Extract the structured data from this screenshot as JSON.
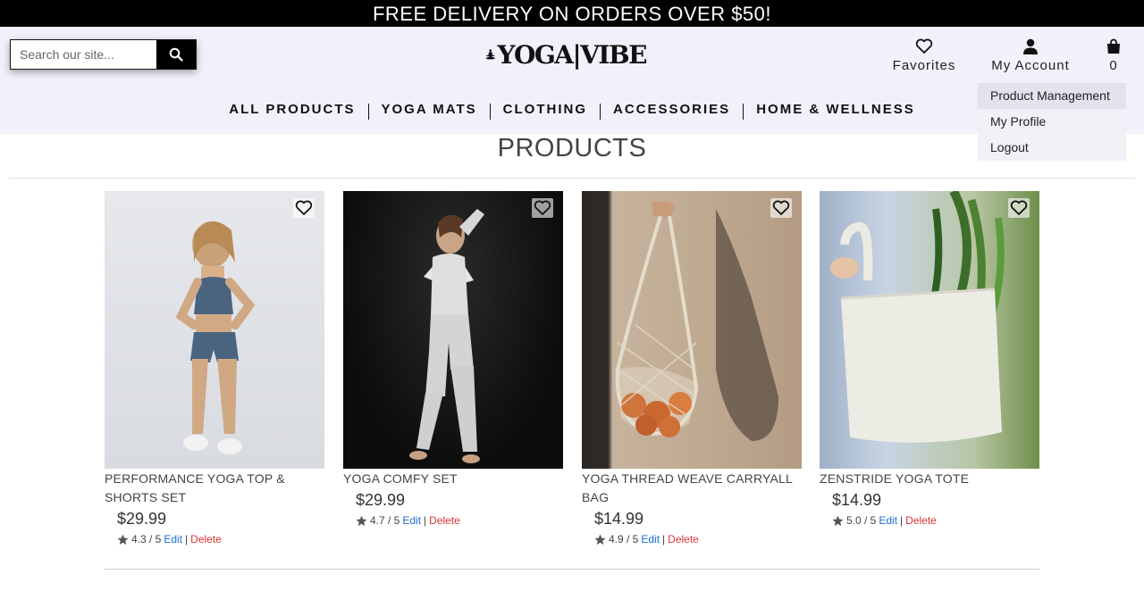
{
  "promo": {
    "text": "FREE DELIVERY ON ORDERS OVER $50!"
  },
  "header": {
    "search": {
      "placeholder": "Search our site..."
    },
    "logo": {
      "text": "YOGA|VIBE",
      "icon": "meditating-person-icon"
    },
    "favorites_label": "Favorites",
    "account_label": "My Account",
    "cart_count": "0"
  },
  "nav": {
    "items": [
      "ALL PRODUCTS",
      "YOGA MATS",
      "CLOTHING",
      "ACCESSORIES",
      "HOME & WELLNESS"
    ]
  },
  "account_menu": {
    "items": [
      "Product Management",
      "My Profile",
      "Logout"
    ]
  },
  "page": {
    "title": "PRODUCTS"
  },
  "products": [
    {
      "name": "PERFORMANCE YOGA TOP & SHORTS SET",
      "price": "$29.99",
      "rating": "4.3 / 5",
      "edit": "Edit",
      "delete": "Delete"
    },
    {
      "name": "YOGA COMFY SET",
      "price": "$29.99",
      "rating": "4.7 / 5",
      "edit": "Edit",
      "delete": "Delete"
    },
    {
      "name": "YOGA THREAD WEAVE CARRYALL BAG",
      "price": "$14.99",
      "rating": "4.9 / 5",
      "edit": "Edit",
      "delete": "Delete"
    },
    {
      "name": "ZENSTRIDE YOGA TOTE",
      "price": "$14.99",
      "rating": "5.0 / 5",
      "edit": "Edit",
      "delete": "Delete"
    }
  ],
  "colors": {
    "promo_bg": "#000000",
    "header_bg": "#f1f1fb",
    "edit_link": "#1a6ed8",
    "delete_link": "#dd3333"
  }
}
